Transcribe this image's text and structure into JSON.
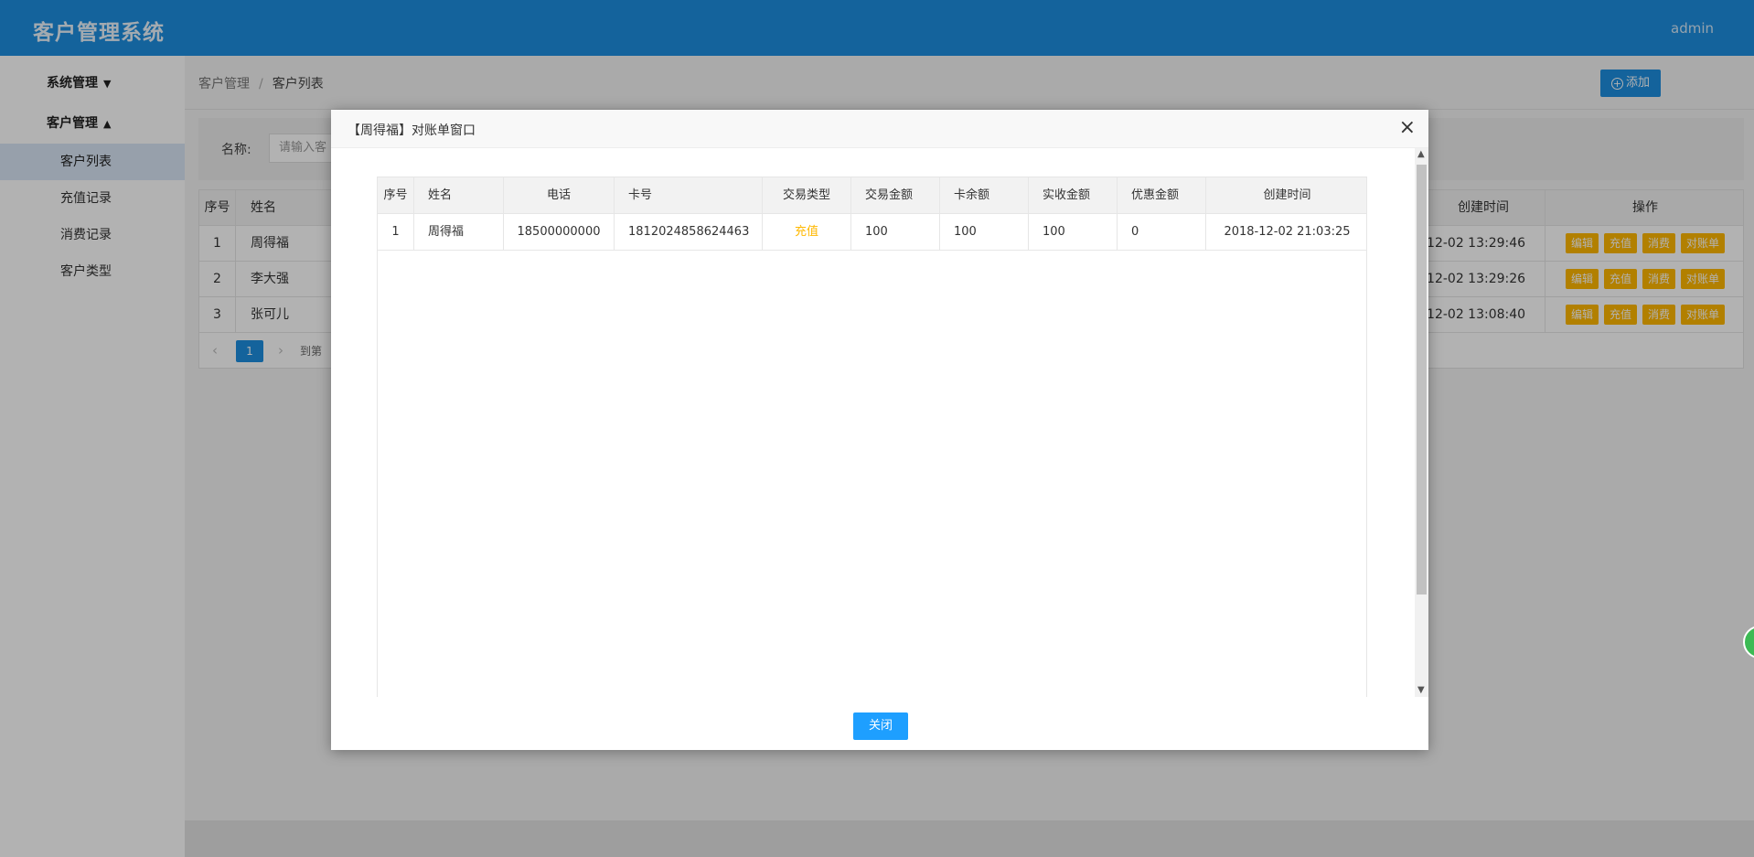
{
  "header": {
    "title": "客户管理系统",
    "user": "admin"
  },
  "sidebar": {
    "groups": [
      {
        "label": "系统管理",
        "chevron": "chevron-down-icon",
        "items": []
      },
      {
        "label": "客户管理",
        "chevron": "chevron-up-icon",
        "items": [
          {
            "label": "客户列表",
            "active": true
          },
          {
            "label": "充值记录",
            "active": false
          },
          {
            "label": "消费记录",
            "active": false
          },
          {
            "label": "客户类型",
            "active": false
          }
        ]
      }
    ]
  },
  "breadcrumb": {
    "parent": "客户管理",
    "separator": "/",
    "current": "客户列表"
  },
  "toolbar": {
    "add_label": "添加"
  },
  "search": {
    "label": "名称:",
    "placeholder": "请输入客"
  },
  "main_table": {
    "headers": {
      "no": "序号",
      "name": "姓名",
      "time": "创建时间",
      "op": "操作"
    },
    "rows": [
      {
        "no": "1",
        "name": "周得福",
        "time": "-12-02 13:29:46"
      },
      {
        "no": "2",
        "name": "李大强",
        "time": "-12-02 13:29:26"
      },
      {
        "no": "3",
        "name": "张可儿",
        "time": "-12-02 13:08:40"
      }
    ],
    "actions": {
      "edit": "编辑",
      "recharge": "充值",
      "consume": "消费",
      "statement": "对账单"
    }
  },
  "pager": {
    "prev": "‹",
    "current_page": "1",
    "next": "›",
    "goto": "到第"
  },
  "modal": {
    "title": "【周得福】对账单窗口",
    "close_icon": "×",
    "columns": [
      "序号",
      "姓名",
      "电话",
      "卡号",
      "交易类型",
      "交易金额",
      "卡余额",
      "实收金额",
      "优惠金额",
      "创建时间"
    ],
    "rows": [
      [
        "1",
        "周得福",
        "18500000000",
        "1812024858624463",
        "充值",
        "100",
        "100",
        "100",
        "0",
        "2018-12-02 21:03:25"
      ]
    ],
    "close_button": "关闭",
    "colors": {
      "recharge_type": "#ffb800",
      "primary": "#1e9fff"
    }
  },
  "colors": {
    "header_bg": "#1e8fe0",
    "warn": "#ffb800"
  }
}
